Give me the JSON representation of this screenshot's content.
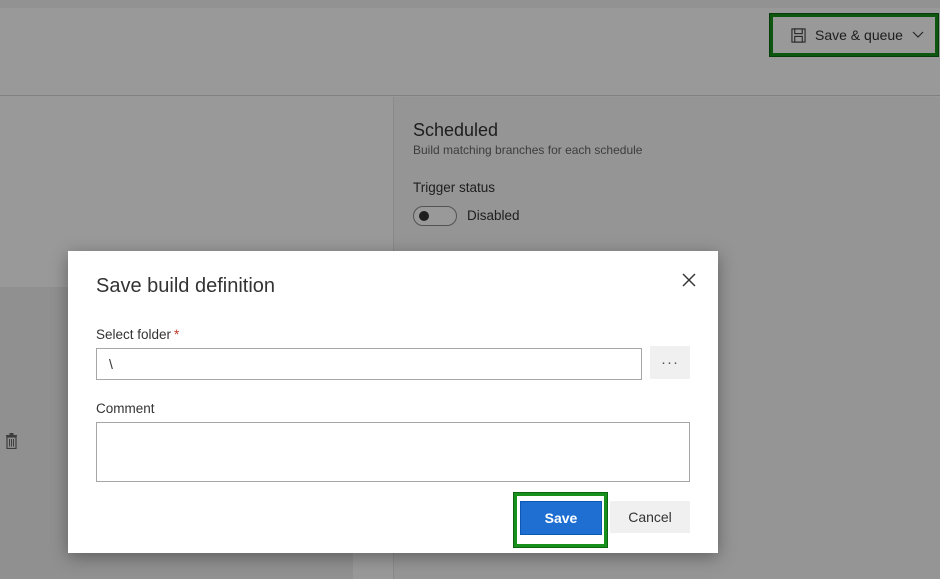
{
  "toolbar": {
    "save_queue_label": "Save & queue",
    "save_icon": "floppy-disk-icon",
    "dropdown_icon": "chevron-down-icon"
  },
  "schedule_panel": {
    "title": "Scheduled",
    "subtitle": "Build matching branches for each schedule",
    "trigger_status_label": "Trigger status",
    "toggle_state_label": "Disabled"
  },
  "left_panel": {
    "delete_icon": "trash-icon"
  },
  "dialog": {
    "title": "Save build definition",
    "close_icon": "close-icon",
    "folder_label": "Select folder",
    "required_marker": "*",
    "folder_value": "\\",
    "browse_label": "···",
    "comment_label": "Comment",
    "comment_value": "",
    "save_label": "Save",
    "cancel_label": "Cancel"
  },
  "colors": {
    "accent": "#1f6fd2",
    "highlight_outline": "#17901c",
    "required": "#c0392b"
  }
}
